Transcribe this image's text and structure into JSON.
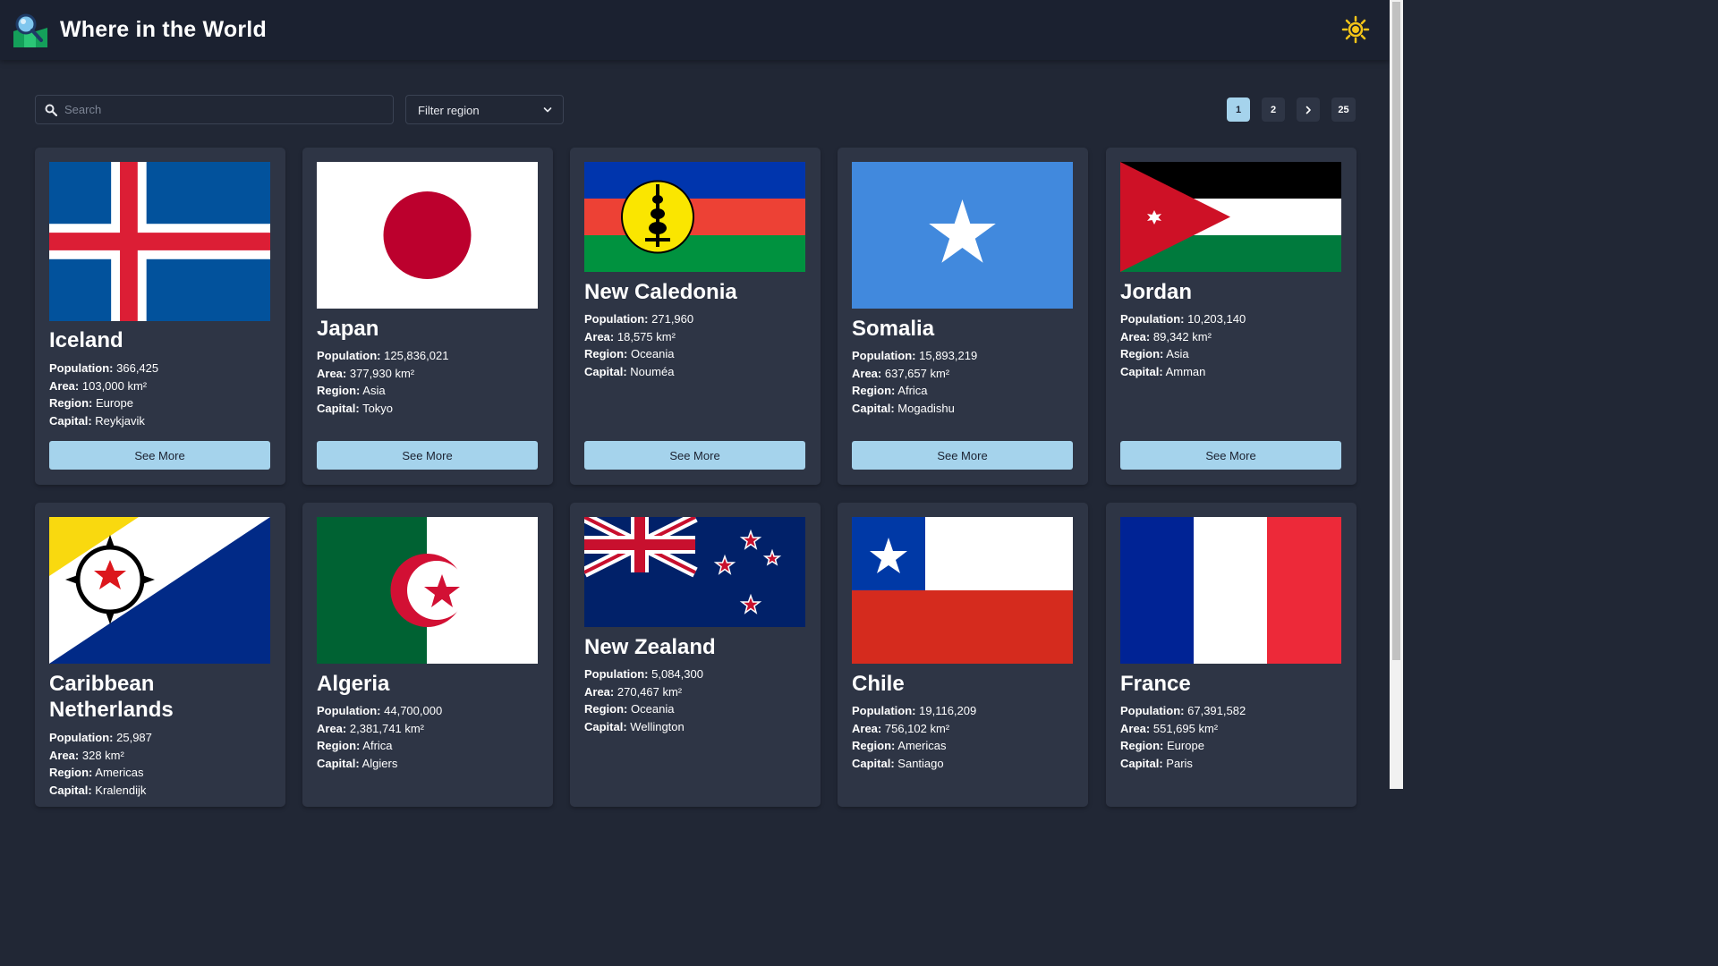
{
  "header": {
    "title": "Where in the World"
  },
  "search": {
    "placeholder": "Search",
    "value": ""
  },
  "filter": {
    "label": "Filter region"
  },
  "pagination": {
    "pages": [
      "1",
      "2",
      "25"
    ],
    "active": "1",
    "next_icon": "chevron-right-icon"
  },
  "labels": {
    "population": "Population:",
    "area": "Area:",
    "region": "Region:",
    "capital": "Capital:",
    "see_more": "See More"
  },
  "colors": {
    "background": "#212735",
    "header": "#1b2130",
    "card": "#2e3545",
    "accent": "#a5d3ec"
  },
  "countries": [
    {
      "name": "Iceland",
      "flag": "iceland-flag",
      "population": "366,425",
      "area": "103,000 km²",
      "region": "Europe",
      "capital": "Reykjavik"
    },
    {
      "name": "Japan",
      "flag": "japan-flag",
      "population": "125,836,021",
      "area": "377,930 km²",
      "region": "Asia",
      "capital": "Tokyo"
    },
    {
      "name": "New Caledonia",
      "flag": "new-caledonia-flag",
      "population": "271,960",
      "area": "18,575 km²",
      "region": "Oceania",
      "capital": "Nouméa"
    },
    {
      "name": "Somalia",
      "flag": "somalia-flag",
      "population": "15,893,219",
      "area": "637,657 km²",
      "region": "Africa",
      "capital": "Mogadishu"
    },
    {
      "name": "Jordan",
      "flag": "jordan-flag",
      "population": "10,203,140",
      "area": "89,342 km²",
      "region": "Asia",
      "capital": "Amman"
    },
    {
      "name": "Caribbean Netherlands",
      "flag": "caribbean-netherlands-flag",
      "population": "25,987",
      "area": "328 km²",
      "region": "Americas",
      "capital": "Kralendijk"
    },
    {
      "name": "Algeria",
      "flag": "algeria-flag",
      "population": "44,700,000",
      "area": "2,381,741 km²",
      "region": "Africa",
      "capital": "Algiers"
    },
    {
      "name": "New Zealand",
      "flag": "new-zealand-flag",
      "population": "5,084,300",
      "area": "270,467 km²",
      "region": "Oceania",
      "capital": "Wellington"
    },
    {
      "name": "Chile",
      "flag": "chile-flag",
      "population": "19,116,209",
      "area": "756,102 km²",
      "region": "Americas",
      "capital": "Santiago"
    },
    {
      "name": "France",
      "flag": "france-flag",
      "population": "67,391,582",
      "area": "551,695 km²",
      "region": "Europe",
      "capital": "Paris"
    }
  ]
}
